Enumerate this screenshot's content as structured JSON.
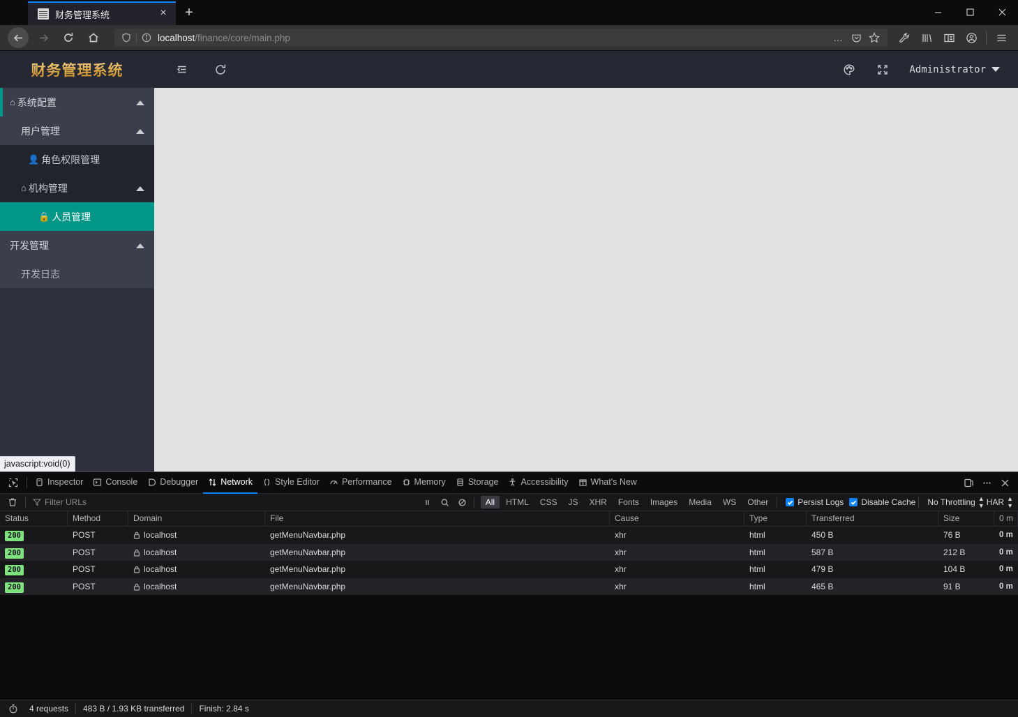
{
  "browser": {
    "tab": {
      "title": "财务管理系统",
      "favicon": "site-favicon",
      "close": "×"
    },
    "new_tab": "+",
    "window_controls": {
      "minimize": "minimize-icon",
      "maximize": "maximize-icon",
      "close": "close-icon"
    },
    "nav": {
      "back": "back-arrow-icon",
      "forward": "forward-arrow-icon",
      "reload": "reload-icon",
      "home": "home-icon"
    },
    "url": {
      "host": "localhost",
      "path": "/finance/core/main.php",
      "shield": "tracking-shield-icon",
      "info": "page-info-icon",
      "more": "…",
      "pocket": "pocket-icon",
      "bookmark": "bookmark-star-icon"
    },
    "toolbar_icons": [
      "wrench-devtools-icon",
      "library-icon",
      "sidebar-icon",
      "account-icon",
      "hamburger-menu-icon"
    ]
  },
  "app": {
    "brand": "财务管理系统",
    "topbar": {
      "collapse_icon": "collapse-sidebar-icon",
      "refresh_icon": "refresh-icon",
      "theme_icon": "palette-theme-icon",
      "fullscreen_icon": "fullscreen-icon",
      "user": "Administrator"
    },
    "sidebar": {
      "items": [
        {
          "label": "系统配置",
          "icon": "house-icon",
          "level": 1,
          "expandable": true
        },
        {
          "label": "用户管理",
          "icon": "",
          "level": 1,
          "expandable": true
        },
        {
          "label": "角色权限管理",
          "icon": "person-icon",
          "level": 2,
          "expandable": false
        },
        {
          "label": "机构管理",
          "icon": "house-icon",
          "level": 2,
          "expandable": true
        },
        {
          "label": "人员管理",
          "icon": "lock-icon",
          "level": 3,
          "active": true
        },
        {
          "label": "开发管理",
          "icon": "",
          "level": 1,
          "expandable": true
        },
        {
          "label": "开发日志",
          "icon": "",
          "level": 2,
          "expandable": false
        }
      ],
      "active_color": "#009688"
    },
    "status_tip": "javascript:void(0)"
  },
  "devtools": {
    "picker_icon": "element-picker-icon",
    "tabs": [
      {
        "label": "Inspector",
        "icon": "inspector-icon",
        "selected": false
      },
      {
        "label": "Console",
        "icon": "console-icon",
        "selected": false
      },
      {
        "label": "Debugger",
        "icon": "debugger-icon",
        "selected": false
      },
      {
        "label": "Network",
        "icon": "network-icon",
        "selected": true
      },
      {
        "label": "Style Editor",
        "icon": "style-editor-icon",
        "selected": false
      },
      {
        "label": "Performance",
        "icon": "performance-icon",
        "selected": false
      },
      {
        "label": "Memory",
        "icon": "memory-icon",
        "selected": false
      },
      {
        "label": "Storage",
        "icon": "storage-icon",
        "selected": false
      },
      {
        "label": "Accessibility",
        "icon": "accessibility-icon",
        "selected": false
      },
      {
        "label": "What's New",
        "icon": "whats-new-gift-icon",
        "selected": false
      }
    ],
    "right_icons": [
      "dock-panel-icon",
      "devtools-more-icon",
      "devtools-close-icon"
    ],
    "filter": {
      "trash_icon": "clear-requests-icon",
      "filter_placeholder": "Filter URLs",
      "filter_value": "",
      "funnel_icon": "funnel-icon",
      "pause_icon": "pause-icon",
      "search_icon": "search-icon",
      "block_icon": "block-icon",
      "types": [
        {
          "label": "All",
          "active": true
        },
        {
          "label": "HTML",
          "active": false
        },
        {
          "label": "CSS",
          "active": false
        },
        {
          "label": "JS",
          "active": false
        },
        {
          "label": "XHR",
          "active": false
        },
        {
          "label": "Fonts",
          "active": false
        },
        {
          "label": "Images",
          "active": false
        },
        {
          "label": "Media",
          "active": false
        },
        {
          "label": "WS",
          "active": false
        },
        {
          "label": "Other",
          "active": false
        }
      ],
      "persist_logs": {
        "label": "Persist Logs",
        "checked": true
      },
      "disable_cache": {
        "label": "Disable Cache",
        "checked": true
      },
      "throttling": "No Throttling",
      "har": "HAR"
    },
    "table": {
      "columns": [
        "Status",
        "Method",
        "Domain",
        "File",
        "Cause",
        "Type",
        "Transferred",
        "Size",
        "0 m"
      ],
      "rows": [
        {
          "status": "200",
          "method": "POST",
          "domain": "localhost",
          "file": "getMenuNavbar.php",
          "cause": "xhr",
          "type": "html",
          "transferred": "450 B",
          "size": "76 B",
          "time": "0 m"
        },
        {
          "status": "200",
          "method": "POST",
          "domain": "localhost",
          "file": "getMenuNavbar.php",
          "cause": "xhr",
          "type": "html",
          "transferred": "587 B",
          "size": "212 B",
          "time": "0 m"
        },
        {
          "status": "200",
          "method": "POST",
          "domain": "localhost",
          "file": "getMenuNavbar.php",
          "cause": "xhr",
          "type": "html",
          "transferred": "479 B",
          "size": "104 B",
          "time": "0 m"
        },
        {
          "status": "200",
          "method": "POST",
          "domain": "localhost",
          "file": "getMenuNavbar.php",
          "cause": "xhr",
          "type": "html",
          "transferred": "465 B",
          "size": "91 B",
          "time": "0 m"
        }
      ]
    },
    "status_bar": {
      "timer_icon": "stopwatch-icon",
      "requests": "4 requests",
      "transferred": "483 B / 1.93 KB transferred",
      "finish": "Finish: 2.84 s"
    }
  }
}
